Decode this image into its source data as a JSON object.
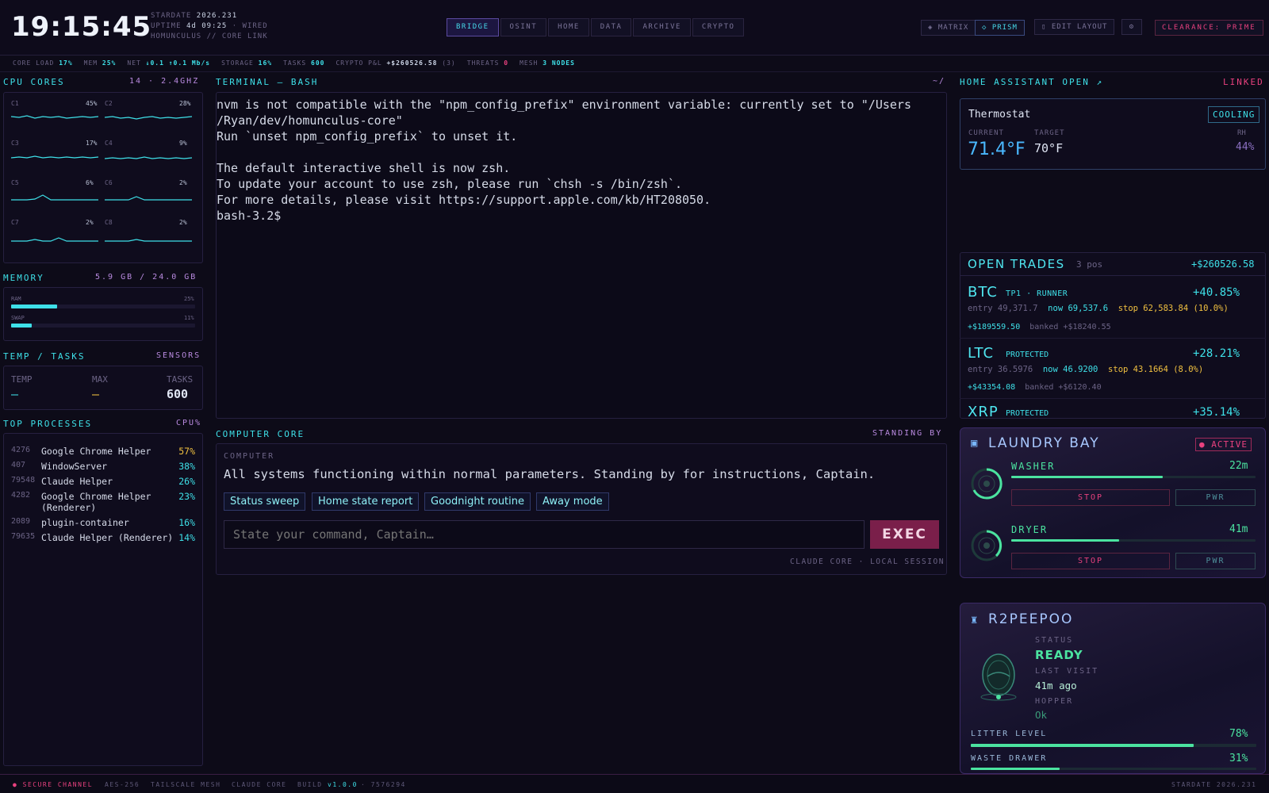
{
  "clock": "19:15:45",
  "header": {
    "stardate_label": "STARDATE",
    "stardate": "2026.231",
    "uptime_label": "UPTIME",
    "uptime": "4d 09:25",
    "wired": "· WIRED",
    "link": "HOMUNCULUS // CORE LINK"
  },
  "nav": {
    "tabs": [
      "BRIDGE",
      "OSINT",
      "HOME",
      "DATA",
      "ARCHIVE",
      "CRYPTO"
    ],
    "active": "BRIDGE"
  },
  "topright": {
    "matrix": "◈ MATRIX",
    "prism": "◇ PRISM",
    "edit_layout": "▯ EDIT LAYOUT",
    "gear": "⚙",
    "clearance": "CLEARANCE: PRIME"
  },
  "stats": {
    "core_load_label": "CORE LOAD",
    "core_load": "17%",
    "mem_label": "MEM",
    "mem": "25%",
    "net_label": "NET",
    "net": "↓0.1 ↑0.1 Mb/s",
    "storage_label": "STORAGE",
    "storage": "16%",
    "tasks_label": "TASKS",
    "tasks": "600",
    "crypto_label": "CRYPTO P&L",
    "crypto": "+$260526.58",
    "crypto_count": "(3)",
    "threats_label": "THREATS",
    "threats": "0",
    "mesh_label": "MESH",
    "mesh": "3 NODES"
  },
  "cpu": {
    "title": "CPU CORES",
    "spec": "14 · 2.4GHZ",
    "cores": [
      {
        "name": "C1",
        "pct": "45%"
      },
      {
        "name": "C2",
        "pct": "28%"
      },
      {
        "name": "C3",
        "pct": "17%"
      },
      {
        "name": "C4",
        "pct": "9%"
      },
      {
        "name": "C5",
        "pct": "6%"
      },
      {
        "name": "C6",
        "pct": "2%"
      },
      {
        "name": "C7",
        "pct": "2%"
      },
      {
        "name": "C8",
        "pct": "2%"
      }
    ]
  },
  "memory": {
    "title": "MEMORY",
    "value": "5.9 GB / 24.0 GB",
    "ram_label": "RAM",
    "ram_pct": "25%",
    "ram_fill": 0.25,
    "swap_label": "SWAP",
    "swap_pct": "11%",
    "swap_fill": 0.11
  },
  "temps": {
    "title": "TEMP / TASKS",
    "sensors": "SENSORS",
    "temp_label": "TEMP",
    "temp": "–",
    "max_label": "MAX",
    "max": "–",
    "tasks_label": "TASKS",
    "tasks": "600"
  },
  "processes": {
    "title": "TOP PROCESSES",
    "sort": "CPU%",
    "rows": [
      {
        "pid": "4276",
        "name": "Google Chrome Helper",
        "pct": "57%"
      },
      {
        "pid": "407",
        "name": "WindowServer",
        "pct": "38%"
      },
      {
        "pid": "79548",
        "name": "Claude Helper",
        "pct": "26%"
      },
      {
        "pid": "4282",
        "name": "Google Chrome Helper (Renderer)",
        "pct": "23%"
      },
      {
        "pid": "2089",
        "name": "plugin-container",
        "pct": "16%"
      },
      {
        "pid": "79635",
        "name": "Claude Helper (Renderer)",
        "pct": "14%"
      }
    ]
  },
  "terminal": {
    "title": "TERMINAL — BASH",
    "path": "~/",
    "text": "nvm is not compatible with the \"npm_config_prefix\" environment variable: currently set to \"/Users\n/Ryan/dev/homunculus-core\"\nRun `unset npm_config_prefix` to unset it.\n\nThe default interactive shell is now zsh.\nTo update your account to use zsh, please run `chsh -s /bin/zsh`.\nFor more details, please visit https://support.apple.com/kb/HT208050.\nbash-3.2$"
  },
  "core": {
    "title": "COMPUTER CORE",
    "status": "STANDING BY",
    "speaker": "COMPUTER",
    "message": "All systems functioning within normal parameters. Standing by for instructions, Captain.",
    "chips": [
      "Status sweep",
      "Home state report",
      "Goodnight routine",
      "Away mode"
    ],
    "placeholder": "State your command, Captain…",
    "exec": "EXEC",
    "footer": "CLAUDE CORE · LOCAL SESSION"
  },
  "home": {
    "title": "HOME ASSISTANT OPEN ↗",
    "status": "LINKED",
    "thermostat": "Thermostat",
    "mode": "COOLING",
    "current_label": "CURRENT",
    "current": "71.4°F",
    "target_label": "TARGET",
    "target": "70°F",
    "rh_label": "RH",
    "rh": "44%"
  },
  "trades": {
    "title": "OPEN TRADES",
    "count": "3 pos",
    "total": "+$260526.58",
    "items": [
      {
        "sym": "BTC",
        "tag": "TP1 · RUNNER",
        "pct": "+40.85%",
        "entry": "entry 49,371.7",
        "now": "now 69,537.6",
        "stop": "stop 62,583.84 (10.0%)",
        "pnl": "+$189559.50",
        "banked": "banked +$18240.55"
      },
      {
        "sym": "LTC",
        "tag": "PROTECTED",
        "pct": "+28.21%",
        "entry": "entry 36.5976",
        "now": "now 46.9200",
        "stop": "stop 43.1664 (8.0%)",
        "pnl": "+$43354.08",
        "banked": "banked +$6120.40"
      },
      {
        "sym": "XRP",
        "tag": "PROTECTED",
        "pct": "+35.14%"
      }
    ]
  },
  "laundry": {
    "title": "LAUNDRY BAY",
    "status": "● ACTIVE",
    "washer": {
      "name": "WASHER",
      "time": "22m",
      "progress": 0.62,
      "stop": "STOP",
      "pwr": "PWR"
    },
    "dryer": {
      "name": "DRYER",
      "time": "41m",
      "progress": 0.44,
      "stop": "STOP",
      "pwr": "PWR"
    }
  },
  "robot": {
    "title": "R2PEEPOO",
    "status_label": "STATUS",
    "status": "READY",
    "visit_label": "LAST VISIT",
    "visit": "41m ago",
    "hopper_label": "HOPPER",
    "hopper": "Ok",
    "litter_label": "LITTER LEVEL",
    "litter": "78%",
    "litter_fill": 0.78,
    "drawer_label": "WASTE DRAWER",
    "drawer": "31%",
    "drawer_fill": 0.31
  },
  "footer": {
    "secure": "● SECURE CHANNEL",
    "aes": "AES-256",
    "mesh": "TAILSCALE MESH",
    "core": "CLAUDE CORE",
    "build_label": "BUILD",
    "build": "v1.0.0",
    "hash": "· 7576294",
    "stardate": "STARDATE 2026.231"
  },
  "colors": {
    "accent": "#3ee0e8",
    "alert": "#e8417e",
    "good": "#4be3a0",
    "warn": "#f0c040"
  }
}
